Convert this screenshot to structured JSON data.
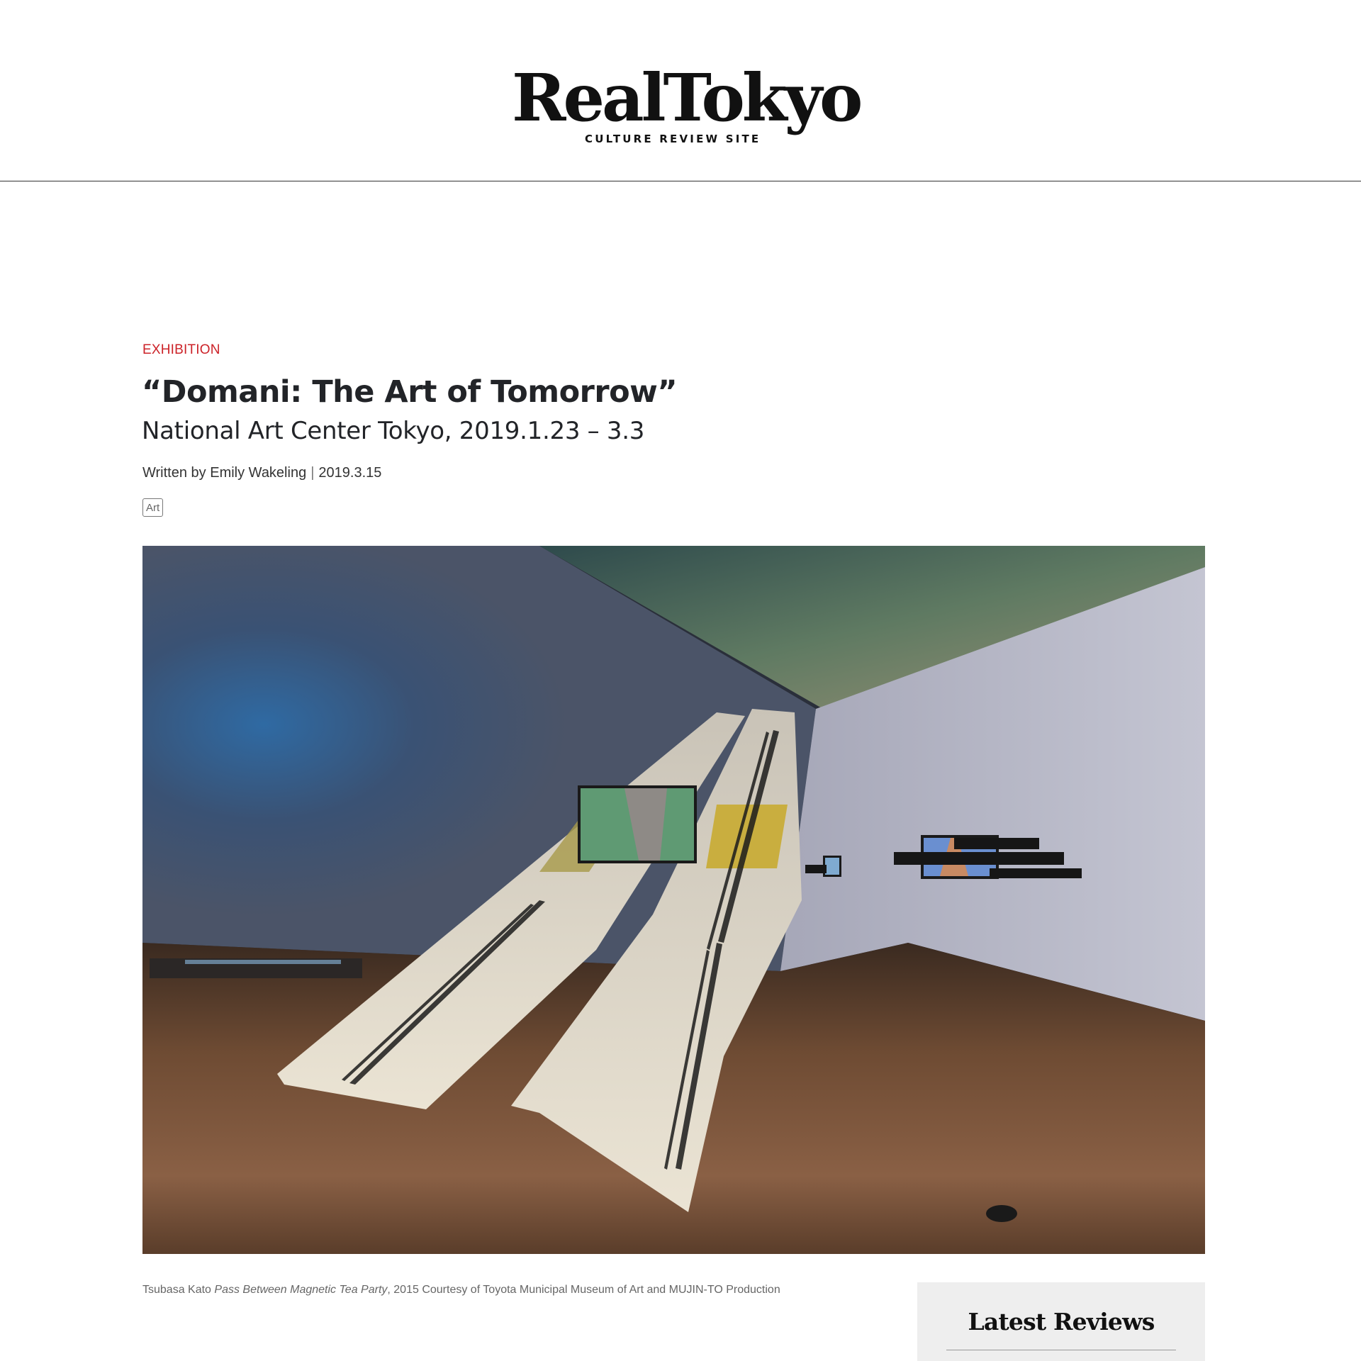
{
  "header": {
    "logo_text": "RealTokyo",
    "logo_tagline": "CULTURE REVIEW SITE"
  },
  "article": {
    "category": "EXHIBITION",
    "title": "“Domani: The Art of Tomorrow”",
    "subtitle": "National Art Center Tokyo, 2019.1.23 – 3.3",
    "byline_prefix": "Written by",
    "author": "Emily Wakeling",
    "byline_separator": "|",
    "date": "2019.3.15",
    "tag": "Art",
    "image_alt": "Installation view of Tsubasa Kato, Pass Between Magnetic Tea Party",
    "caption_artist": "Tsubasa Kato",
    "caption_work": "Pass Between Magnetic Tea Party",
    "caption_rest": ", 2015 Courtesy of Toyota Municipal Museum of Art and MUJIN-TO Production"
  },
  "sidebar": {
    "latest_title": "Latest Reviews"
  },
  "colors": {
    "accent": "#cc2228",
    "text": "#222428",
    "sidebar_bg": "#eeeeee"
  }
}
